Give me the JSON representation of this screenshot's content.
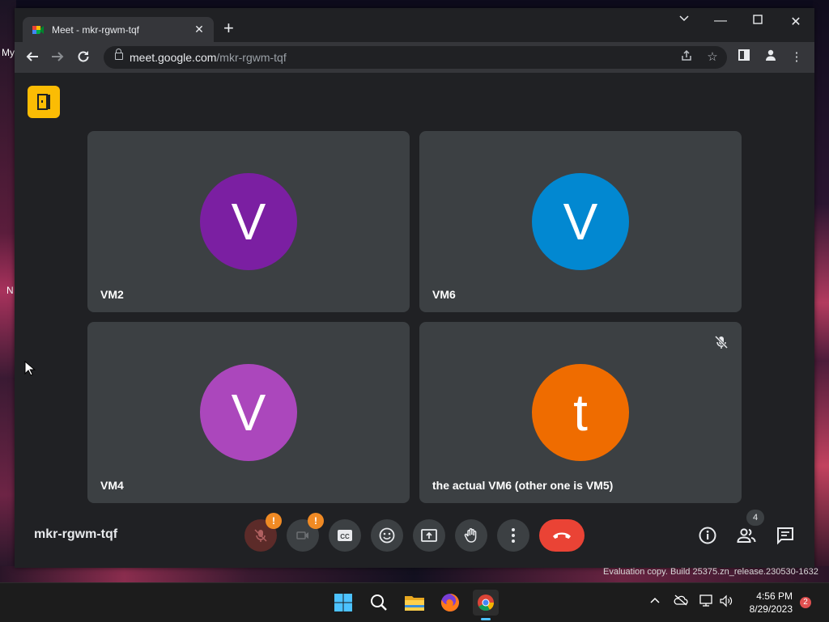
{
  "desktop": {
    "left_text_1": "My",
    "left_text_2": "N",
    "watermark": "Evaluation copy. Build 25375.zn_release.230530-1632"
  },
  "browser": {
    "tab_title": "Meet - mkr-rgwm-tqf",
    "url_host": "meet.google.com",
    "url_path": "/mkr-rgwm-tqf"
  },
  "meet": {
    "meeting_code": "mkr-rgwm-tqf",
    "participant_count": "4",
    "tiles": [
      {
        "initial": "V",
        "name": "VM2",
        "color": "#7b1fa2"
      },
      {
        "initial": "V",
        "name": "VM6",
        "color": "#0288d1"
      },
      {
        "initial": "V",
        "name": "VM4",
        "color": "#ab47bc"
      },
      {
        "initial": "t",
        "name": "the actual VM6 (other one is VM5)",
        "color": "#ef6c00"
      }
    ],
    "alert_mic": "!",
    "alert_cam": "!"
  },
  "taskbar": {
    "time": "4:56 PM",
    "date": "8/29/2023",
    "notifications": "2"
  }
}
